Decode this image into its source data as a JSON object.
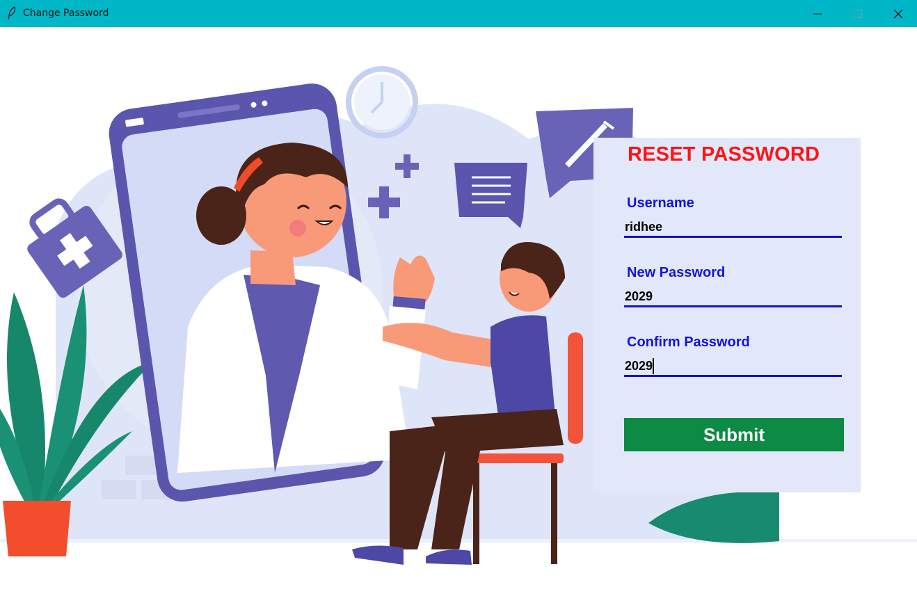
{
  "window": {
    "title": "Change Password",
    "app_icon": "feather-icon",
    "controls": [
      "minimize-icon",
      "maximize-icon",
      "close-icon"
    ],
    "titlebar_color": "#00b7c7"
  },
  "form": {
    "heading": "RESET PASSWORD",
    "username_label": "Username",
    "username_value": "ridhee",
    "new_password_label": "New Password",
    "new_password_value": "2029",
    "confirm_password_label": "Confirm Password",
    "confirm_password_value": "2029",
    "submit_label": "Submit",
    "heading_color": "#ff1414",
    "label_color": "#1212e0",
    "submit_color": "#0d8a43"
  }
}
